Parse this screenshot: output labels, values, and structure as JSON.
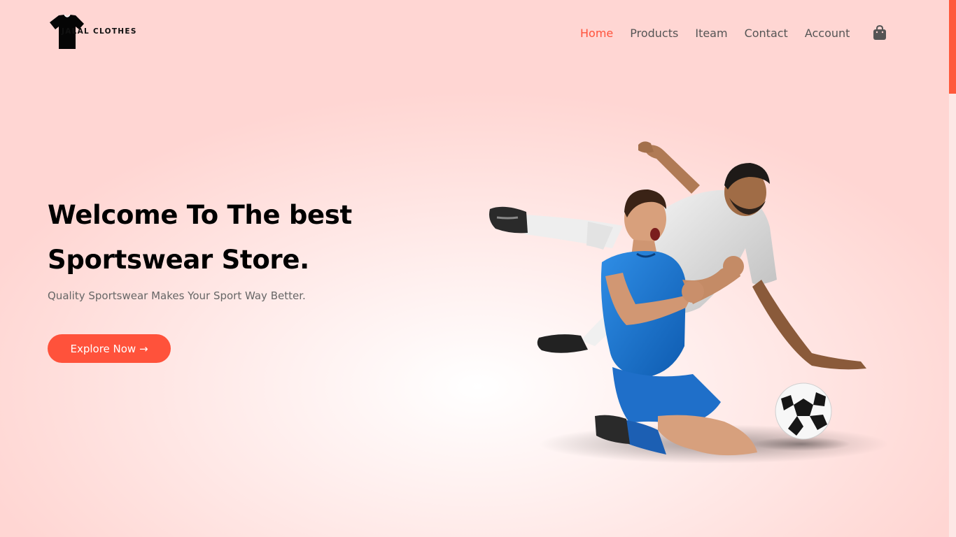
{
  "brand": {
    "name": "JALAL CLOTHES",
    "logo_icon": "t-shirt-icon"
  },
  "nav": {
    "items": [
      {
        "label": "Home",
        "active": true
      },
      {
        "label": "Products",
        "active": false
      },
      {
        "label": "Iteam",
        "active": false
      },
      {
        "label": "Contact",
        "active": false
      },
      {
        "label": "Account",
        "active": false
      }
    ],
    "cart_icon": "shopping-bag-icon"
  },
  "hero": {
    "title_line1": "Welcome To The best",
    "title_line2": "Sportswear Store.",
    "subtitle": "Quality Sportswear Makes Your Sport Way Better.",
    "button_label": "Explore Now →",
    "image": "football-players-celebration-image"
  },
  "colors": {
    "accent": "#ff523b",
    "background": "#ffd6d3",
    "heading": "#000000",
    "text": "#555555"
  }
}
